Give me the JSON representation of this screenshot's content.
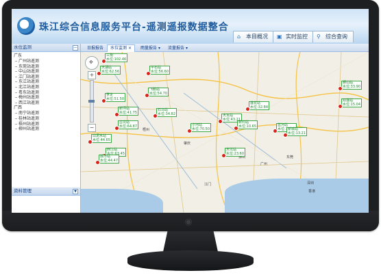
{
  "app": {
    "title": "珠江综合信息服务平台-遥测遥报数据整合",
    "top_buttons": [
      {
        "label": "本目概况",
        "icon": "home-icon"
      },
      {
        "label": "实时监控",
        "icon": "monitor-icon"
      },
      {
        "label": "综合查询",
        "icon": "search-icon"
      }
    ]
  },
  "left_panel": {
    "header": "水位监测",
    "groups": [
      {
        "name": "广东",
        "items": [
          "广州站遥测",
          "东莞站遥测",
          "中山站遥测",
          "江门站遥测",
          "东江站遥测",
          "北江站遥测",
          "粤东站遥测",
          "梅州站遥测",
          "西江站遥测"
        ]
      },
      {
        "name": "广西",
        "items": [
          "南宁站遥测",
          "桂林站遥测",
          "梧州站遥测",
          "柳州站遥测"
        ]
      }
    ],
    "bottom_header": "资料管理"
  },
  "tabs": [
    {
      "label": "日报报告"
    },
    {
      "label": "水位监测",
      "closable": true,
      "active": true
    },
    {
      "label": "雨量报告"
    },
    {
      "label": "流量报告"
    }
  ],
  "map": {
    "zoom_in": "+",
    "zoom_out": "−",
    "zoom_level": 0.5,
    "city_labels": [
      "广州",
      "东莞",
      "深圳",
      "香港",
      "佛山",
      "江门",
      "肇庆",
      "梧州"
    ],
    "stations": [
      {
        "name": "三角",
        "value": "水位:102.46",
        "pin": true
      },
      {
        "name": "大湖站",
        "value": "水位:62.56",
        "pin": true
      },
      {
        "name": "平石站",
        "value": "水位:56.60",
        "pin": true
      },
      {
        "name": "飞鹅站",
        "value": "水位:54.70",
        "pin": true
      },
      {
        "name": "罗定",
        "value": "水位:51.50",
        "pin": true
      },
      {
        "name": "新坪站",
        "value": "水位:41.75",
        "pin": true
      },
      {
        "name": "石马站",
        "value": "水位:34.82",
        "pin": true
      },
      {
        "name": "古坑站",
        "value": "水位:64.87",
        "pin": true
      },
      {
        "name": "白泥水站",
        "value": "水位:44.65",
        "pin": true
      },
      {
        "name": "西江站",
        "value": "水位:63.45",
        "pin": true
      },
      {
        "name": "城市站",
        "value": "水位:44.47",
        "pin": true
      },
      {
        "name": "大瓦站",
        "value": "水位:43.21",
        "pin": true
      },
      {
        "name": "小河站",
        "value": "水位:70.50",
        "pin": true
      },
      {
        "name": "狮山站",
        "value": "水位:33.90",
        "pin": true
      },
      {
        "name": "双莲站",
        "value": "水位:15.04",
        "pin": true
      },
      {
        "name": "莲花站",
        "value": "水位:32.84",
        "pin": true
      },
      {
        "name": "新村站",
        "value": "水位:10.65",
        "pin": true
      },
      {
        "name": "蓝河站",
        "value": "水位:14.72",
        "pin": true
      },
      {
        "name": "新城站",
        "value": "水位:13.21",
        "pin": true
      },
      {
        "name": "大坑站",
        "value": "水位:23.60",
        "pin": true
      }
    ]
  }
}
